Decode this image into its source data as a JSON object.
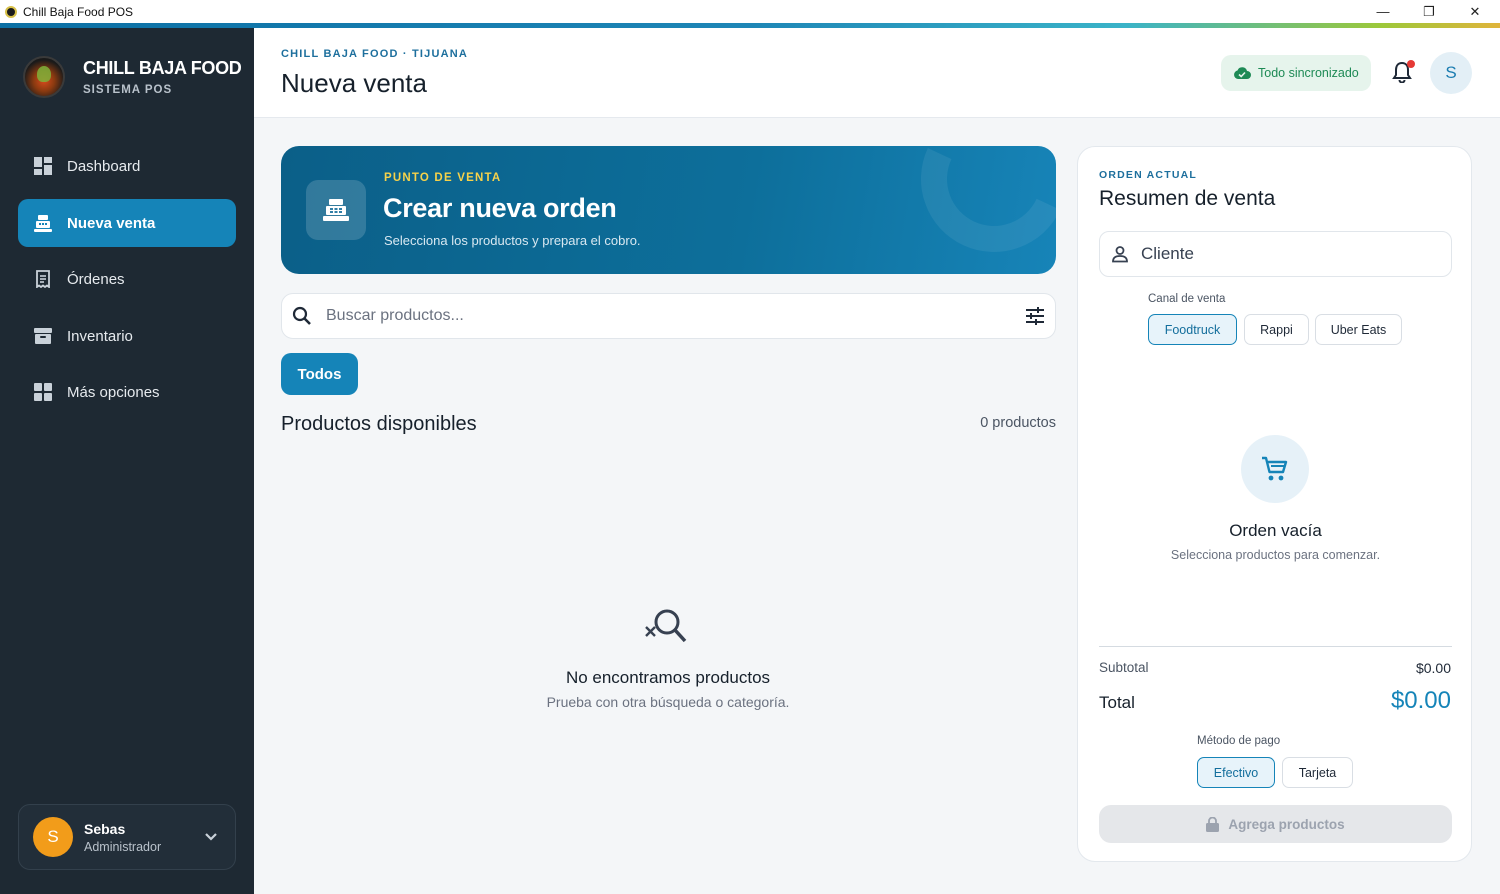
{
  "window": {
    "title": "Chill Baja Food POS",
    "minimize": "—",
    "maximize": "❐",
    "close": "✕"
  },
  "brand": {
    "name": "CHILL BAJA FOOD",
    "subtitle": "SISTEMA POS"
  },
  "sidebar": {
    "items": [
      {
        "label": "Dashboard",
        "icon": "dashboard-icon",
        "active": false
      },
      {
        "label": "Nueva venta",
        "icon": "cash-register-icon",
        "active": true
      },
      {
        "label": "Órdenes",
        "icon": "receipt-icon",
        "active": false
      },
      {
        "label": "Inventario",
        "icon": "inventory-icon",
        "active": false
      },
      {
        "label": "Más opciones",
        "icon": "grid-icon",
        "active": false
      }
    ]
  },
  "user": {
    "initial": "S",
    "name": "Sebas",
    "role": "Administrador"
  },
  "header": {
    "breadcrumb": "CHILL BAJA FOOD · TIJUANA",
    "title": "Nueva venta",
    "sync_status": "Todo sincronizado",
    "avatar_initial": "S"
  },
  "hero": {
    "eyebrow": "PUNTO DE VENTA",
    "title": "Crear nueva orden",
    "subtitle": "Selecciona los productos y prepara el cobro."
  },
  "search": {
    "placeholder": "Buscar productos..."
  },
  "filters": {
    "active_category": "Todos"
  },
  "products": {
    "section_title": "Productos disponibles",
    "count_label": "0 productos",
    "empty_title": "No encontramos productos",
    "empty_subtitle": "Prueba con otra búsqueda o categoría."
  },
  "order": {
    "eyebrow": "ORDEN ACTUAL",
    "title": "Resumen de venta",
    "client_label": "Cliente",
    "channel_label": "Canal de venta",
    "channels": [
      {
        "label": "Foodtruck",
        "selected": true
      },
      {
        "label": "Rappi",
        "selected": false
      },
      {
        "label": "Uber Eats",
        "selected": false
      }
    ],
    "empty_title": "Orden vacía",
    "empty_subtitle": "Selecciona productos para comenzar.",
    "subtotal_label": "Subtotal",
    "subtotal_value": "$0.00",
    "total_label": "Total",
    "total_value": "$0.00",
    "payment_label": "Método de pago",
    "payment_methods": [
      {
        "label": "Efectivo",
        "selected": true
      },
      {
        "label": "Tarjeta",
        "selected": false
      }
    ],
    "cta_label": "Agrega productos"
  },
  "colors": {
    "accent": "#1584b8",
    "sidebar_bg": "#1e2933",
    "hero_bg": "#0d6f9b",
    "eyebrow_yellow": "#f7d24a",
    "sync_green": "#1e8a55"
  }
}
